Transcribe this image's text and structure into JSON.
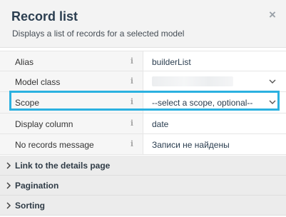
{
  "header": {
    "title": "Record list",
    "description": "Displays a list of records for a selected model",
    "close_glyph": "×"
  },
  "properties": [
    {
      "label": "Alias",
      "value": "builderList",
      "type": "text"
    },
    {
      "label": "Model class",
      "value": "",
      "type": "dropdown-blurred"
    },
    {
      "label": "Scope",
      "value": "--select a scope, optional--",
      "type": "dropdown",
      "focused": true
    },
    {
      "label": "Display column",
      "value": "date",
      "type": "text"
    },
    {
      "label": "No records message",
      "value": "Записи не найдены",
      "type": "text"
    }
  ],
  "info_glyph": "i",
  "sections": [
    {
      "label": "Link to the details page"
    },
    {
      "label": "Pagination"
    },
    {
      "label": "Sorting"
    }
  ],
  "colors": {
    "focus": "#2bb1e0",
    "header_bg": "#f3f3f3",
    "section_bg": "#ececec"
  },
  "icons": {
    "close": "close-icon",
    "info": "info-icon",
    "dropdown": "chevron-down-icon",
    "section": "chevron-right-icon"
  }
}
